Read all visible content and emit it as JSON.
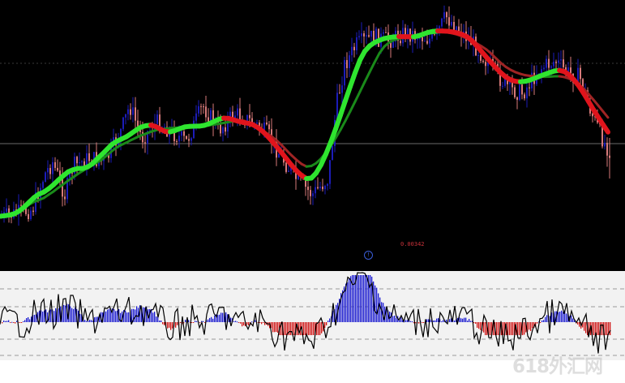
{
  "price_label": "0.00342",
  "info_icon_glyph": "!",
  "watermark": "618外汇网",
  "colors": {
    "background": "#000000",
    "candle_up": "#1c1cb8",
    "candle_down": "#d77a7a",
    "ma_rising": "#2fe52f",
    "ma_falling": "#e0141c",
    "ma_slow_rising": "#1a8a1a",
    "ma_slow_falling": "#a02424",
    "osc_positive": "#1a1ad0",
    "osc_negative": "#d01414",
    "osc_panel": "#f2f2f2",
    "osc_line": "#000000"
  },
  "icons": [
    "info-icon"
  ]
}
